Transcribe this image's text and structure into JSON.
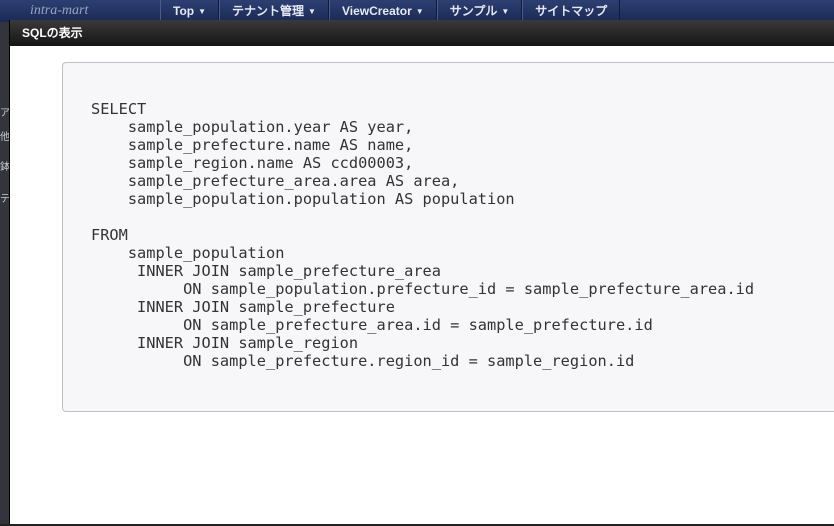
{
  "app": {
    "logo": "intra-mart",
    "nav": [
      {
        "label": "Top"
      },
      {
        "label": "テナント管理"
      },
      {
        "label": "ViewCreator"
      },
      {
        "label": "サンプル"
      },
      {
        "label": "サイトマップ",
        "dropdown": false
      }
    ],
    "left_fragments": [
      "ア",
      "他",
      "鉢",
      "テ"
    ]
  },
  "dialog": {
    "title": "SQLの表示",
    "sql": "SELECT\n    sample_population.year AS year,\n    sample_prefecture.name AS name,\n    sample_region.name AS ccd00003,\n    sample_prefecture_area.area AS area,\n    sample_population.population AS population\n\nFROM\n    sample_population\n     INNER JOIN sample_prefecture_area\n          ON sample_population.prefecture_id = sample_prefecture_area.id\n     INNER JOIN sample_prefecture\n          ON sample_prefecture_area.id = sample_prefecture.id\n     INNER JOIN sample_region\n          ON sample_prefecture.region_id = sample_region.id"
  }
}
